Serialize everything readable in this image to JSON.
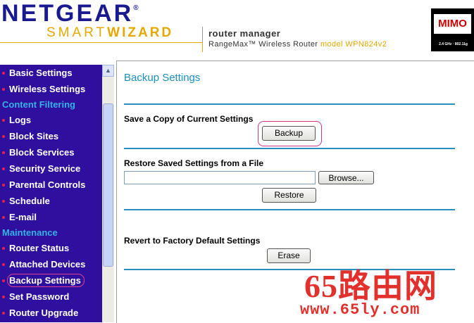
{
  "header": {
    "brand": "NETGEAR",
    "brand_mark": "®",
    "wizard_light": "SMART",
    "wizard_bold": "WIZARD",
    "product_title": "router manager",
    "product_sub": "RangeMax™ Wireless Router",
    "product_model": "model WPN824v2",
    "badge_main": "MIMO",
    "badge_sub": "2.4 GHz · 802.11g"
  },
  "sidebar": {
    "items": [
      {
        "type": "item",
        "label": "Basic Settings"
      },
      {
        "type": "item",
        "label": "Wireless Settings"
      },
      {
        "type": "header",
        "label": "Content Filtering"
      },
      {
        "type": "item",
        "label": "Logs"
      },
      {
        "type": "item",
        "label": "Block Sites"
      },
      {
        "type": "item",
        "label": "Block Services"
      },
      {
        "type": "item",
        "label": "Security Service"
      },
      {
        "type": "item",
        "label": "Parental Controls"
      },
      {
        "type": "item",
        "label": "Schedule"
      },
      {
        "type": "item",
        "label": "E-mail"
      },
      {
        "type": "header",
        "label": "Maintenance"
      },
      {
        "type": "item",
        "label": "Router Status"
      },
      {
        "type": "item",
        "label": "Attached Devices"
      },
      {
        "type": "item",
        "label": "Backup Settings",
        "active": true
      },
      {
        "type": "item",
        "label": "Set Password"
      },
      {
        "type": "item",
        "label": "Router Upgrade"
      }
    ],
    "scroll_up_glyph": "▲"
  },
  "main": {
    "title": "Backup Settings",
    "save_label": "Save a Copy of Current Settings",
    "backup_button": "Backup",
    "restore_label": "Restore Saved Settings from a File",
    "file_value": "",
    "browse_button": "Browse...",
    "restore_button": "Restore",
    "revert_label": "Revert to Factory Default Settings",
    "erase_button": "Erase"
  },
  "watermark": {
    "big": "65路由网",
    "small": "www.65ly.com"
  },
  "colors": {
    "sidebar_bg": "#2f0f9e",
    "menu_header": "#36b2e6",
    "bullet": "#e8214b",
    "accent_rule": "#2a8fba",
    "title": "#1b8fc1",
    "brand": "#1a1a90",
    "wizard": "#e6a800",
    "highlight": "#d0348a",
    "watermark": "#e2312d"
  }
}
